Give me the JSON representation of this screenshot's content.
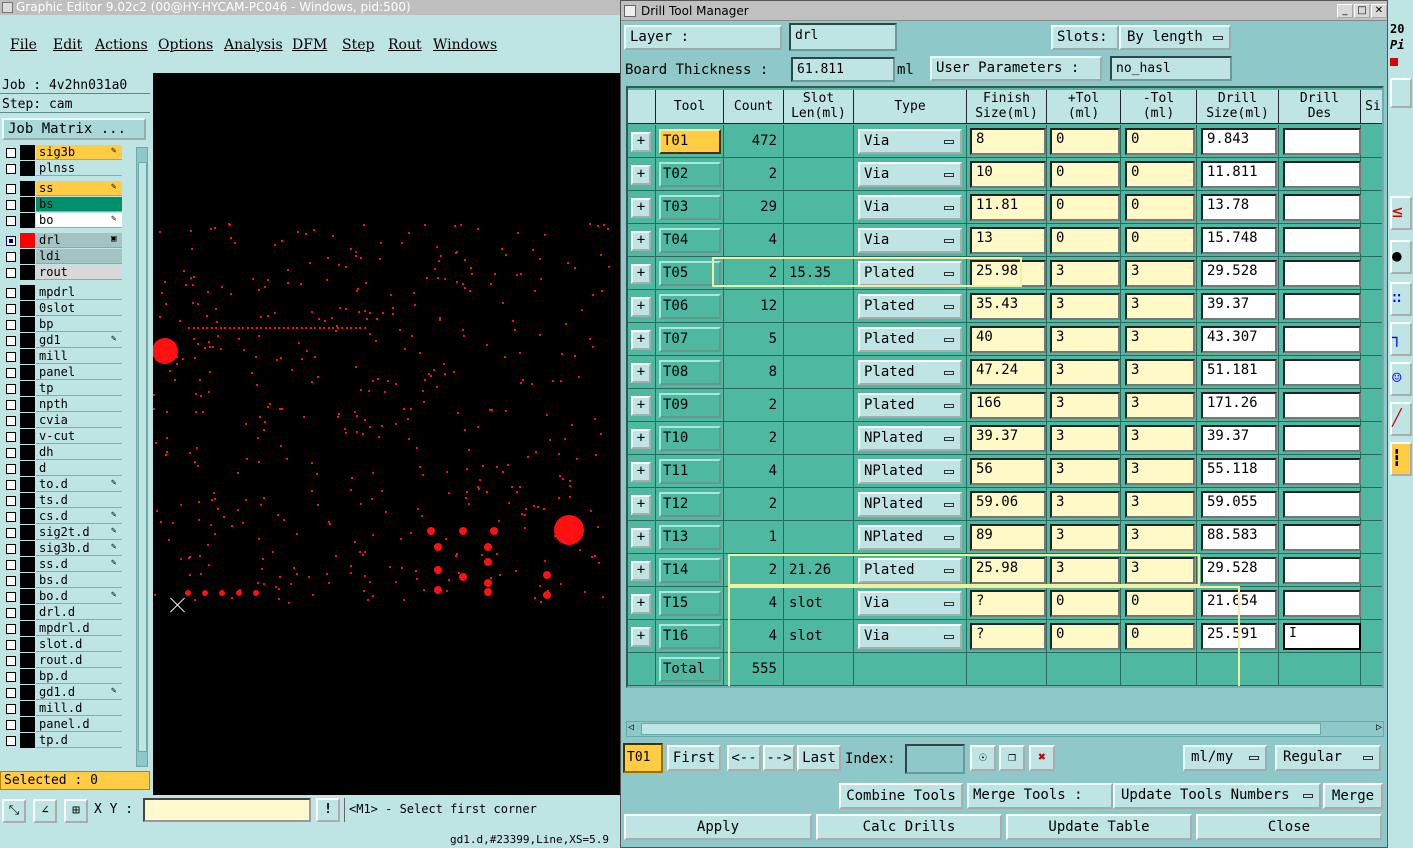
{
  "main_window": {
    "title": "Graphic Editor 9.02c2 (00@HY-HYCAM-PC046 - Windows, pid:500)",
    "menu": [
      "File",
      "Edit",
      "Actions",
      "Options",
      "Analysis",
      "DFM",
      "Step",
      "Rout",
      "Windows"
    ],
    "job": "Job : 4v2hn031a0",
    "step": "Step: cam",
    "job_matrix": "Job Matrix ...",
    "layers": [
      {
        "name": "sig3b",
        "style": "orange",
        "mark": "✎"
      },
      {
        "name": "plnss",
        "style": "",
        "mark": ""
      },
      {
        "name": "ss",
        "style": "orange",
        "mark": "✎"
      },
      {
        "name": "bs",
        "style": "green",
        "mark": ""
      },
      {
        "name": "bo",
        "style": "white",
        "mark": "✎"
      },
      {
        "name": "drl",
        "style": "gray",
        "mark": "▣",
        "active": true
      },
      {
        "name": "ldi",
        "style": "gray",
        "mark": ""
      },
      {
        "name": "rout",
        "style": "lgray",
        "mark": ""
      },
      {
        "name": "mpdrl",
        "style": "",
        "mark": ""
      },
      {
        "name": "0slot",
        "style": "",
        "mark": ""
      },
      {
        "name": "bp",
        "style": "",
        "mark": ""
      },
      {
        "name": "gd1",
        "style": "",
        "mark": "✎"
      },
      {
        "name": "mill",
        "style": "",
        "mark": ""
      },
      {
        "name": "panel",
        "style": "",
        "mark": ""
      },
      {
        "name": "tp",
        "style": "",
        "mark": ""
      },
      {
        "name": "npth",
        "style": "",
        "mark": ""
      },
      {
        "name": "cvia",
        "style": "",
        "mark": ""
      },
      {
        "name": "v-cut",
        "style": "",
        "mark": ""
      },
      {
        "name": "dh",
        "style": "",
        "mark": ""
      },
      {
        "name": "d",
        "style": "",
        "mark": ""
      },
      {
        "name": "to.d",
        "style": "",
        "mark": "✎"
      },
      {
        "name": "ts.d",
        "style": "",
        "mark": ""
      },
      {
        "name": "cs.d",
        "style": "",
        "mark": "✎"
      },
      {
        "name": "sig2t.d",
        "style": "",
        "mark": "✎"
      },
      {
        "name": "sig3b.d",
        "style": "",
        "mark": "✎"
      },
      {
        "name": "ss.d",
        "style": "",
        "mark": "✎"
      },
      {
        "name": "bs.d",
        "style": "",
        "mark": ""
      },
      {
        "name": "bo.d",
        "style": "",
        "mark": "✎"
      },
      {
        "name": "drl.d",
        "style": "",
        "mark": ""
      },
      {
        "name": "mpdrl.d",
        "style": "",
        "mark": ""
      },
      {
        "name": "slot.d",
        "style": "",
        "mark": ""
      },
      {
        "name": "rout.d",
        "style": "",
        "mark": ""
      },
      {
        "name": "bp.d",
        "style": "",
        "mark": ""
      },
      {
        "name": "gd1.d",
        "style": "",
        "mark": "✎"
      },
      {
        "name": "mill.d",
        "style": "",
        "mark": ""
      },
      {
        "name": "panel.d",
        "style": "",
        "mark": ""
      },
      {
        "name": "tp.d",
        "style": "",
        "mark": ""
      }
    ],
    "selected": "Selected : 0",
    "xy_label": "X Y :",
    "xy_value": "",
    "prompt": "<M1> - Select first corner",
    "status_line": "gd1.d,#23399,Line,XS=5.9",
    "colors": {
      "canvas": "#000000",
      "features": "#ff1010",
      "panel": "#bfe4e4",
      "highlight": "#ffcc44"
    }
  },
  "dialog": {
    "title": "Drill Tool Manager",
    "layer_label": "Layer          :",
    "layer_value": "drl",
    "slots_label": "Slots:",
    "slots_value": "By length",
    "board_thickness_label": "Board Thickness :",
    "board_thickness_value": "61.811",
    "board_thickness_unit": "ml",
    "user_params_label": "User Parameters :",
    "user_params_value": "no_hasl",
    "headers": [
      "Tool",
      "Count",
      "Slot\nLen(ml)",
      "Type",
      "Finish\nSize(ml)",
      "+Tol\n(ml)",
      "-Tol\n(ml)",
      "Drill\nSize(ml)",
      "Drill\nDes",
      "Si"
    ],
    "rows": [
      {
        "tool": "T01",
        "count": "472",
        "slot": "",
        "type": "Via",
        "finish": "8",
        "ptol": "0",
        "ntol": "0",
        "drill": "9.843",
        "des": ""
      },
      {
        "tool": "T02",
        "count": "2",
        "slot": "",
        "type": "Via",
        "finish": "10",
        "ptol": "0",
        "ntol": "0",
        "drill": "11.811",
        "des": ""
      },
      {
        "tool": "T03",
        "count": "29",
        "slot": "",
        "type": "Via",
        "finish": "11.81",
        "ptol": "0",
        "ntol": "0",
        "drill": "13.78",
        "des": ""
      },
      {
        "tool": "T04",
        "count": "4",
        "slot": "",
        "type": "Via",
        "finish": "13",
        "ptol": "0",
        "ntol": "0",
        "drill": "15.748",
        "des": ""
      },
      {
        "tool": "T05",
        "count": "2",
        "slot": "15.35",
        "type": "Plated",
        "finish": "25.98",
        "ptol": "3",
        "ntol": "3",
        "drill": "29.528",
        "des": ""
      },
      {
        "tool": "T06",
        "count": "12",
        "slot": "",
        "type": "Plated",
        "finish": "35.43",
        "ptol": "3",
        "ntol": "3",
        "drill": "39.37",
        "des": ""
      },
      {
        "tool": "T07",
        "count": "5",
        "slot": "",
        "type": "Plated",
        "finish": "40",
        "ptol": "3",
        "ntol": "3",
        "drill": "43.307",
        "des": ""
      },
      {
        "tool": "T08",
        "count": "8",
        "slot": "",
        "type": "Plated",
        "finish": "47.24",
        "ptol": "3",
        "ntol": "3",
        "drill": "51.181",
        "des": ""
      },
      {
        "tool": "T09",
        "count": "2",
        "slot": "",
        "type": "Plated",
        "finish": "166",
        "ptol": "3",
        "ntol": "3",
        "drill": "171.26",
        "des": ""
      },
      {
        "tool": "T10",
        "count": "2",
        "slot": "",
        "type": "NPlated",
        "finish": "39.37",
        "ptol": "3",
        "ntol": "3",
        "drill": "39.37",
        "des": ""
      },
      {
        "tool": "T11",
        "count": "4",
        "slot": "",
        "type": "NPlated",
        "finish": "56",
        "ptol": "3",
        "ntol": "3",
        "drill": "55.118",
        "des": ""
      },
      {
        "tool": "T12",
        "count": "2",
        "slot": "",
        "type": "NPlated",
        "finish": "59.06",
        "ptol": "3",
        "ntol": "3",
        "drill": "59.055",
        "des": ""
      },
      {
        "tool": "T13",
        "count": "1",
        "slot": "",
        "type": "NPlated",
        "finish": "89",
        "ptol": "3",
        "ntol": "3",
        "drill": "88.583",
        "des": ""
      },
      {
        "tool": "T14",
        "count": "2",
        "slot": "21.26",
        "type": "Plated",
        "finish": "25.98",
        "ptol": "3",
        "ntol": "3",
        "drill": "29.528",
        "des": ""
      },
      {
        "tool": "T15",
        "count": "4",
        "slot": "slot",
        "type": "Via",
        "finish": "?",
        "ptol": "0",
        "ntol": "0",
        "drill": "21.654",
        "des": ""
      },
      {
        "tool": "T16",
        "count": "4",
        "slot": "slot",
        "type": "Via",
        "finish": "?",
        "ptol": "0",
        "ntol": "0",
        "drill": "25.591",
        "des": "I"
      }
    ],
    "total_label": "Total",
    "total_count": "555",
    "nav": {
      "current": "T01",
      "first": "First",
      "prev": "<--",
      "next": "-->",
      "last": "Last",
      "index_label": "Index:",
      "index_value": "",
      "units": "ml/my",
      "mode": "Regular"
    },
    "actions_row1": {
      "combine": "Combine Tools",
      "merge_label": "Merge Tools :",
      "merge_value": "Update Tools Numbers",
      "merge": "Merge"
    },
    "actions_row2": {
      "apply": "Apply",
      "calc": "Calc Drills",
      "update": "Update Table",
      "close": "Close"
    }
  },
  "right_strip": {
    "top_text": "20",
    "sub_text": "Pi"
  }
}
